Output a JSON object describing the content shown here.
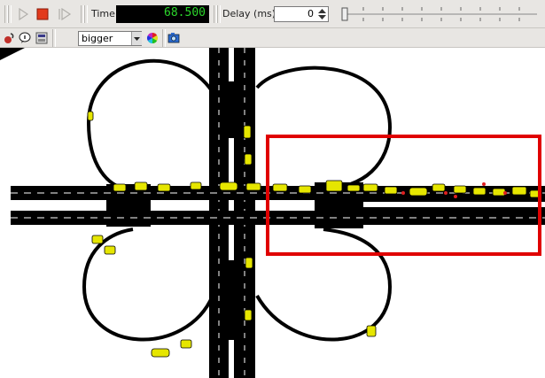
{
  "toolbar": {
    "time_label": "Time:",
    "time_value": "68.500",
    "delay_label": "Delay (ms):",
    "delay_value": "0"
  },
  "view_toolbar": {
    "scheme_value": "bigger"
  },
  "colors": {
    "lcd_text": "#2bd62b",
    "road": "#000000",
    "vehicle": "#e6e600",
    "highlight_box": "#e00000",
    "stop_button": "#e23a1c"
  },
  "icons": [
    "play-icon",
    "stop-icon",
    "step-icon",
    "spin-icon",
    "slider-icon",
    "locate-icon",
    "info-icon",
    "edit-view-icon",
    "dropdown-icon",
    "color-wheel-icon",
    "camera-icon"
  ]
}
